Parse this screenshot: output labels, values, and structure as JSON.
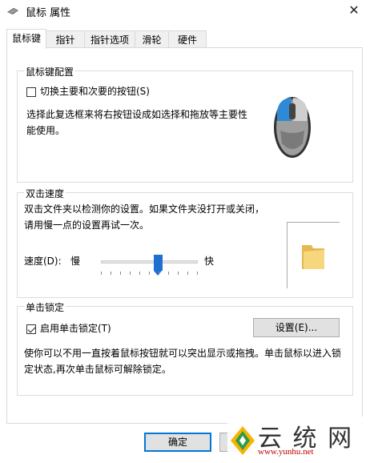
{
  "window": {
    "title": "鼠标 属性",
    "close_symbol": "✕",
    "icon": "mouse-icon"
  },
  "tabs": [
    {
      "label": "鼠标键",
      "active": true
    },
    {
      "label": "指针",
      "active": false
    },
    {
      "label": "指针选项",
      "active": false
    },
    {
      "label": "滑轮",
      "active": false
    },
    {
      "label": "硬件",
      "active": false
    }
  ],
  "button_config": {
    "title": "鼠标键配置",
    "switch_label": "切换主要和次要的按钮(S)",
    "switch_checked": false,
    "description": "选择此复选框来将右按钮设成如选择和拖放等主要性能使用。",
    "mouse_image": "mouse-image-icon"
  },
  "double_click": {
    "title": "双击速度",
    "description": "双击文件夹以检测你的设置。如果文件夹没打开或关闭，请用慢一点的设置再试一次。",
    "speed_label": "速度(D):",
    "slow_label": "慢",
    "fast_label": "快",
    "speed_value": 0.59,
    "folder": "folder-icon"
  },
  "click_lock": {
    "title": "单击锁定",
    "enable_label": "启用单击锁定(T)",
    "enable_checked": true,
    "settings_button": "设置(E)...",
    "description": "使你可以不用一直按着鼠标按钮就可以突出显示或拖拽。单击鼠标以进入锁定状态,再次单击鼠标可解除锁定。"
  },
  "footer": {
    "ok_label": "确定"
  },
  "watermark": {
    "text": "云 统 网",
    "url": "www.yunhu.net",
    "logo": "yunhu-logo-icon"
  },
  "colors": {
    "accent": "#1f6fd1",
    "mouse_highlight": "#2e8ad6"
  }
}
